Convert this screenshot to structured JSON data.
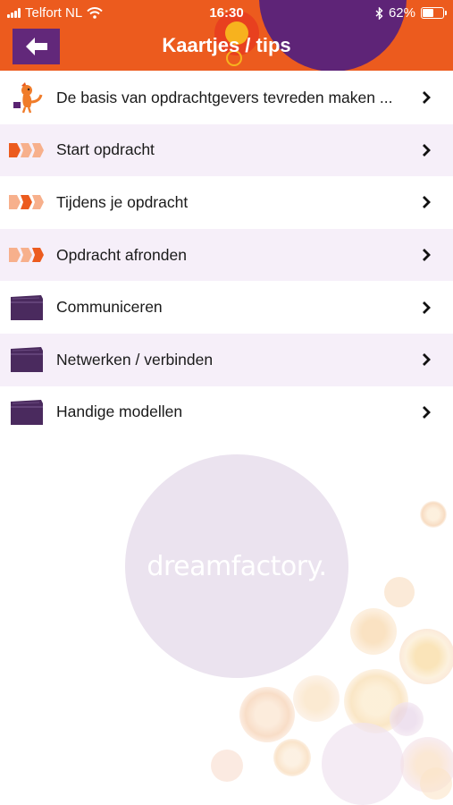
{
  "status_bar": {
    "carrier": "Telfort NL",
    "time": "16:30",
    "battery": "62%",
    "battery_level": 0.62
  },
  "header": {
    "title": "Kaartjes / tips",
    "back_icon": "arrow-left-icon"
  },
  "items": [
    {
      "label": "De basis van opdrachtgevers tevreden maken ...",
      "icon": "fox-mascot-icon"
    },
    {
      "label": "Start opdracht",
      "icon": "progress-step-1-icon"
    },
    {
      "label": "Tijdens je opdracht",
      "icon": "progress-step-2-icon"
    },
    {
      "label": "Opdracht afronden",
      "icon": "progress-step-3-icon"
    },
    {
      "label": "Communiceren",
      "icon": "folder-icon"
    },
    {
      "label": "Netwerken / verbinden",
      "icon": "folder-icon"
    },
    {
      "label": "Handige modellen",
      "icon": "folder-icon"
    }
  ],
  "logo_text": "dreamfactory.",
  "colors": {
    "header": "#ec5b1e",
    "purple": "#62287a",
    "row_alt": "#f6eff9",
    "step_active": "#ec5b1e",
    "step_inactive": "#f7b08c"
  }
}
